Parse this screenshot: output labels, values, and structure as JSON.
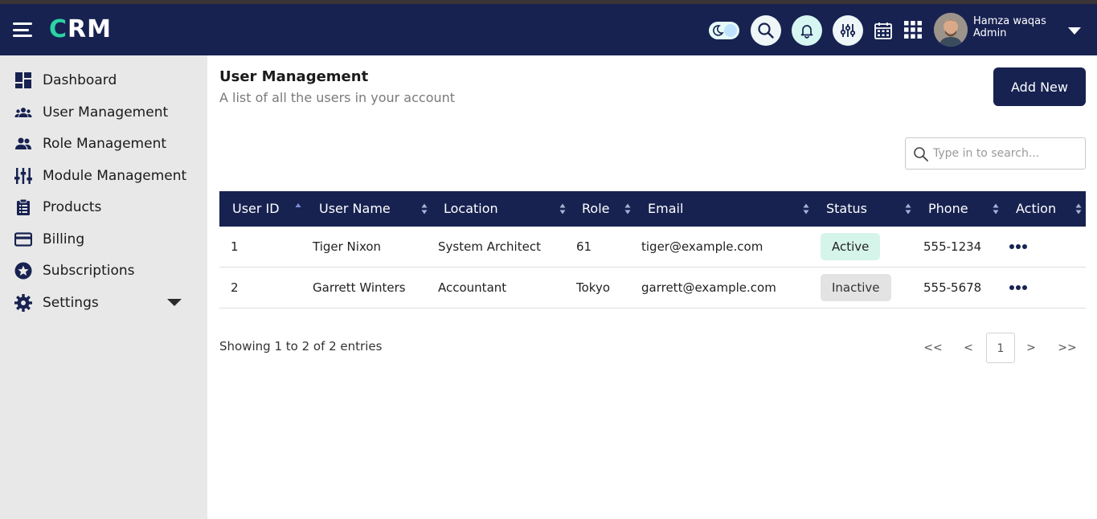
{
  "header": {
    "logo_first": "C",
    "logo_rest": "RM",
    "user_name": "Hamza waqas",
    "user_role": "Admin",
    "icons": [
      "menu-icon",
      "theme-toggle",
      "search-icon",
      "bell-icon",
      "sliders-icon",
      "calendar-icon",
      "apps-grid-icon",
      "avatar",
      "chevron-down-icon"
    ]
  },
  "sidebar": {
    "items": [
      {
        "label": "Dashboard",
        "icon": "dashboard-icon"
      },
      {
        "label": "User Management",
        "icon": "users-icon"
      },
      {
        "label": "Role Management",
        "icon": "role-icon"
      },
      {
        "label": "Module Management",
        "icon": "module-icon"
      },
      {
        "label": "Products",
        "icon": "clipboard-icon"
      },
      {
        "label": "Billing",
        "icon": "credit-card-icon"
      },
      {
        "label": "Subscriptions",
        "icon": "star-badge-icon"
      },
      {
        "label": "Settings",
        "icon": "gear-icon"
      }
    ]
  },
  "page": {
    "title": "User Management",
    "subtitle": "A list of all the users in your account",
    "add_button": "Add New",
    "search_placeholder": "Type in to search..."
  },
  "table": {
    "columns": [
      "User ID",
      "User Name",
      "Location",
      "Role",
      "Email",
      "Status",
      "Phone",
      "Action"
    ],
    "rows": [
      {
        "id": "1",
        "name": "Tiger Nixon",
        "location": "System Architect",
        "role": "61",
        "email": "tiger@example.com",
        "status": "Active",
        "phone": "555-1234"
      },
      {
        "id": "2",
        "name": "Garrett Winters",
        "location": "Accountant",
        "role": "Tokyo",
        "email": "garrett@example.com",
        "status": "Inactive",
        "phone": "555-5678"
      }
    ]
  },
  "footer": {
    "showing": "Showing 1 to 2 of 2 entries",
    "first": "<<",
    "prev": "<",
    "current": "1",
    "next": ">",
    "last": ">>"
  },
  "colors": {
    "navy": "#172251",
    "accent_green": "#2bd3a5",
    "sidebar_bg": "#e8e8e8",
    "active_badge": "#d6f5ea",
    "inactive_badge": "#e3e3e3"
  }
}
